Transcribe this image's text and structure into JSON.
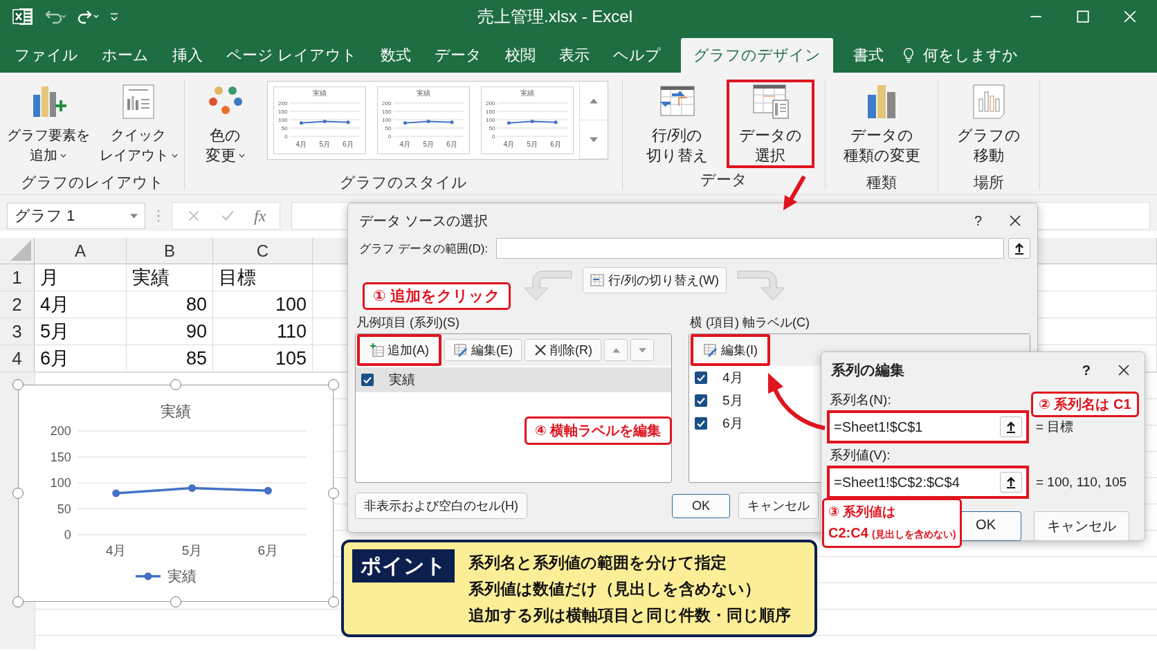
{
  "title_bar": {
    "title": "売上管理.xlsx  -  Excel"
  },
  "menu_tabs": [
    {
      "label": "ファイル",
      "selected": false
    },
    {
      "label": "ホーム",
      "selected": false
    },
    {
      "label": "挿入",
      "selected": false
    },
    {
      "label": "ページ レイアウト",
      "selected": false
    },
    {
      "label": "数式",
      "selected": false
    },
    {
      "label": "データ",
      "selected": false
    },
    {
      "label": "校閲",
      "selected": false
    },
    {
      "label": "表示",
      "selected": false
    },
    {
      "label": "ヘルプ",
      "selected": false
    },
    {
      "label": "グラフのデザイン",
      "selected": true
    },
    {
      "label": "書式",
      "selected": false
    }
  ],
  "tell_me": {
    "label": "何をしますか"
  },
  "ribbon": {
    "groups": [
      {
        "kind": "buttons",
        "label": "グラフのレイアウト",
        "buttons": [
          {
            "kind": "add-element",
            "lines": [
              "グラフ要素を",
              "追加"
            ],
            "dropdown": true,
            "highlighted": false
          },
          {
            "kind": "quick-layout",
            "lines": [
              "クイック",
              "レイアウト"
            ],
            "dropdown": true,
            "highlighted": false
          }
        ]
      },
      {
        "kind": "styles",
        "label": "グラフのスタイル",
        "buttons": [
          {
            "kind": "palette",
            "lines": [
              "色の",
              "変更"
            ],
            "dropdown": true,
            "highlighted": false
          }
        ],
        "thumbnails": [
          {
            "chart_data": {
              "type": "line",
              "title": "実績",
              "categories": [
                "4月",
                "5月",
                "6月"
              ],
              "series": [
                {
                  "color": "#4472c4",
                  "marker": true,
                  "values": [
                    80,
                    90,
                    85
                  ]
                }
              ],
              "ylim": [
                0,
                200
              ],
              "yticks": [
                0,
                50,
                100,
                150,
                200
              ],
              "grid": true
            }
          },
          {
            "chart_data": {
              "type": "line",
              "title": "実績",
              "categories": [
                "4月",
                "5月",
                "6月"
              ],
              "series": [
                {
                  "color": "#4472c4",
                  "marker": true,
                  "values": [
                    80,
                    90,
                    85
                  ]
                }
              ],
              "ylim": [
                0,
                200
              ],
              "yticks": [
                0,
                50,
                100,
                150,
                200
              ],
              "grid": true
            }
          },
          {
            "chart_data": {
              "type": "line",
              "title": "実績",
              "categories": [
                "4月",
                "5月",
                "6月"
              ],
              "series": [
                {
                  "color": "#4472c4",
                  "marker": true,
                  "values": [
                    80,
                    90,
                    85
                  ]
                }
              ],
              "ylim": [
                0,
                200
              ],
              "yticks": [
                0,
                50,
                100,
                150,
                200
              ],
              "grid": true
            }
          }
        ]
      },
      {
        "kind": "buttons",
        "label": "データ",
        "buttons": [
          {
            "kind": "switch",
            "lines": [
              "行/列の",
              "切り替え"
            ],
            "dropdown": false,
            "highlighted": false
          },
          {
            "kind": "select-data",
            "lines": [
              "データの",
              "選択"
            ],
            "dropdown": false,
            "highlighted": true
          }
        ]
      },
      {
        "kind": "buttons",
        "label": "種類",
        "buttons": [
          {
            "kind": "chart-type",
            "lines": [
              "データの",
              "種類の変更"
            ],
            "dropdown": false,
            "highlighted": false
          }
        ]
      },
      {
        "kind": "buttons",
        "label": "場所",
        "buttons": [
          {
            "kind": "move-chart",
            "lines": [
              "グラフの",
              "移動"
            ],
            "dropdown": false,
            "highlighted": false
          }
        ]
      }
    ]
  },
  "formula_bar": {
    "name_box": "グラフ 1",
    "fx": "fx"
  },
  "sheet": {
    "columns": [
      "A",
      "B",
      "C"
    ],
    "rows": [
      {
        "number": "1",
        "cells": [
          {
            "text": "月",
            "kind": "text"
          },
          {
            "text": "実績",
            "kind": "text"
          },
          {
            "text": "目標",
            "kind": "text"
          }
        ]
      },
      {
        "number": "2",
        "cells": [
          {
            "text": "4月",
            "kind": "text"
          },
          {
            "text": "80",
            "kind": "number"
          },
          {
            "text": "100",
            "kind": "number"
          }
        ]
      },
      {
        "number": "3",
        "cells": [
          {
            "text": "5月",
            "kind": "text"
          },
          {
            "text": "90",
            "kind": "number"
          },
          {
            "text": "110",
            "kind": "number"
          }
        ]
      },
      {
        "number": "4",
        "cells": [
          {
            "text": "6月",
            "kind": "text"
          },
          {
            "text": "85",
            "kind": "number"
          },
          {
            "text": "105",
            "kind": "number"
          }
        ]
      }
    ]
  },
  "sheet_chart": {
    "selected": true,
    "chart_data": {
      "type": "line",
      "title": "実績",
      "categories": [
        "4月",
        "5月",
        "6月"
      ],
      "series": [
        {
          "name": "実績",
          "color": "#4472c4",
          "marker": true,
          "values": [
            80,
            90,
            85
          ]
        }
      ],
      "ylim": [
        0,
        200
      ],
      "yticks": [
        0,
        50,
        100,
        150,
        200
      ],
      "grid": true
    }
  },
  "data_source_dialog": {
    "title": "データ ソースの選択",
    "help": "?",
    "range_label": "グラフ データの範囲(D):",
    "switch_button": "行/列の切り替え(W)",
    "legend_label": "凡例項目 (系列)(S)",
    "legend_tools": [
      {
        "kind": "add",
        "label": "追加(A)",
        "highlighted": true
      },
      {
        "kind": "edit",
        "label": "編集(E)",
        "highlighted": false
      },
      {
        "kind": "delete",
        "label": "削除(R)",
        "highlighted": false
      },
      {
        "kind": "up",
        "disabled": true
      },
      {
        "kind": "down",
        "disabled": true
      }
    ],
    "legend_items": [
      {
        "label": "実績",
        "checked": true,
        "selected": true
      }
    ],
    "axis_label": "横 (項目) 軸ラベル(C)",
    "axis_tools": [
      {
        "kind": "edit",
        "label": "編集(I)",
        "highlighted": true
      }
    ],
    "axis_items": [
      {
        "label": "4月",
        "checked": true
      },
      {
        "label": "5月",
        "checked": true
      },
      {
        "label": "6月",
        "checked": true
      }
    ],
    "hidden_cells_button": "非表示および空白のセル(H)",
    "ok": "OK",
    "cancel": "キャンセル"
  },
  "series_dialog": {
    "title": "系列の編集",
    "help": "?",
    "fields": [
      {
        "label": "系列名(N):",
        "value": "=Sheet1!$C$1",
        "result": "= 目標",
        "highlighted": true
      },
      {
        "label": "系列値(V):",
        "value": "=Sheet1!$C$2:$C$4",
        "result": "= 100, 110, 105",
        "highlighted": true
      }
    ],
    "ok": "OK",
    "cancel": "キャンセル"
  },
  "callouts": [
    {
      "text": "① 追加をクリック"
    },
    {
      "text": "② 系列名は C1"
    },
    {
      "text": "③ 系列値は",
      "detail": "C2:C4",
      "note": "(見出しを含めない)"
    },
    {
      "text": "④ 横軸ラベルを編集"
    }
  ],
  "point_box": {
    "label": "ポイント",
    "lines": [
      "系列名と系列値の範囲を分けて指定",
      "系列値は数値だけ（見出しを含めない）",
      "追加する列は横軸項目と同じ件数・同じ順序"
    ]
  }
}
